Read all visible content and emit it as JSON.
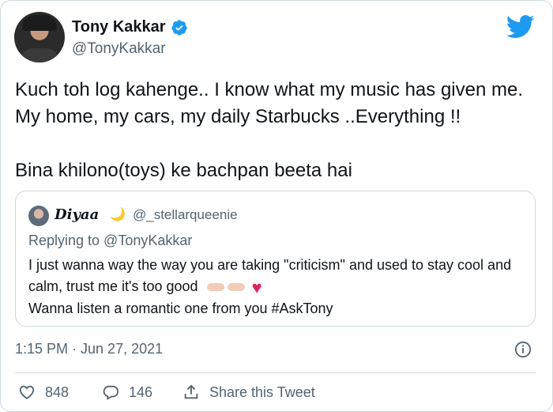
{
  "author": {
    "name": "Tony Kakkar",
    "handle": "@TonyKakkar"
  },
  "icons": {
    "verified": "verified-badge-icon",
    "twitter": "twitter-bird-icon",
    "info": "info-icon",
    "like": "heart-outline-icon",
    "reply": "reply-bubble-icon",
    "share": "share-icon"
  },
  "tweet": {
    "text": "Kuch toh log kahenge.. I know what my music has given me. My home, my cars, my daily Starbucks ..Everything !!\n\nBina khilono(toys) ke bachpan beeta hai",
    "timestamp": "1:15 PM · Jun 27, 2021"
  },
  "quoted": {
    "name": "Diyaa",
    "handle": "@_stellarqueenie",
    "replying_to": "Replying to @TonyKakkar",
    "text_line1": "I just wanna way the way you are taking \"criticism\" and used to stay cool and calm, trust me it's too good",
    "text_line2": "Wanna listen a romantic one from you #AskTony"
  },
  "actions": {
    "likes": "848",
    "replies": "146",
    "share_label": "Share this Tweet"
  },
  "colors": {
    "brand": "#1d9bf0",
    "text": "#0f1419",
    "secondary": "#536471",
    "border": "#cfd9de",
    "heart": "#e0245e"
  }
}
